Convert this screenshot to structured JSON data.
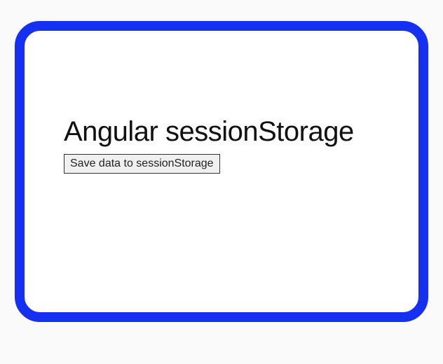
{
  "card": {
    "heading": "Angular sessionStorage",
    "save_button_label": "Save data to sessionStorage"
  },
  "colors": {
    "border": "#1530f0",
    "background": "#ffffff"
  }
}
